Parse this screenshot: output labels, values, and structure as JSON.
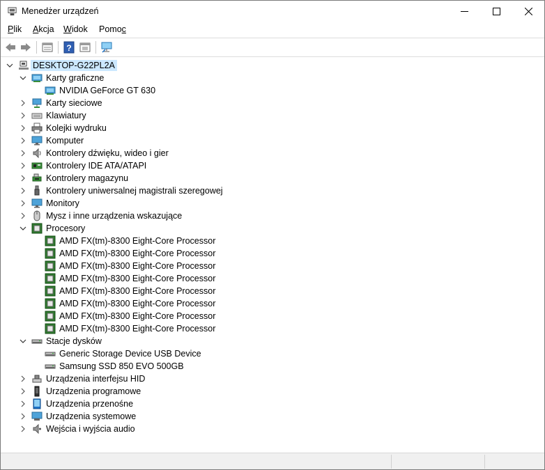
{
  "window": {
    "title": "Menedżer urządzeń"
  },
  "menu": [
    {
      "name": "menu-plik",
      "pre": "",
      "u": "P",
      "post": "lik"
    },
    {
      "name": "menu-akcja",
      "pre": "",
      "u": "A",
      "post": "kcja"
    },
    {
      "name": "menu-widok",
      "pre": "",
      "u": "W",
      "post": "idok"
    },
    {
      "name": "menu-pomoc",
      "pre": "Pomo",
      "u": "c",
      "post": ""
    }
  ],
  "toolbar": [
    "back-icon",
    "forward-icon",
    "properties-icon",
    "help-icon",
    "driver-details-icon",
    "scan-hardware-icon"
  ],
  "tree": {
    "root": "DESKTOP-G22PL2A",
    "rows": [
      {
        "label": "Karty graficzne",
        "level": 1,
        "state": "expanded",
        "icon": "display-adapter-icon"
      },
      {
        "label": "NVIDIA GeForce GT 630",
        "level": 2,
        "icon": "display-adapter-icon"
      },
      {
        "label": "Karty sieciowe",
        "level": 1,
        "state": "collapsed",
        "icon": "network-adapter-icon"
      },
      {
        "label": "Klawiatury",
        "level": 1,
        "state": "collapsed",
        "icon": "keyboard-icon"
      },
      {
        "label": "Kolejki wydruku",
        "level": 1,
        "state": "collapsed",
        "icon": "printer-icon"
      },
      {
        "label": "Komputer",
        "level": 1,
        "state": "collapsed",
        "icon": "computer-icon"
      },
      {
        "label": "Kontrolery dźwięku, wideo i gier",
        "level": 1,
        "state": "collapsed",
        "icon": "speaker-icon"
      },
      {
        "label": "Kontrolery IDE ATA/ATAPI",
        "level": 1,
        "state": "collapsed",
        "icon": "ide-controller-icon"
      },
      {
        "label": "Kontrolery magazynu",
        "level": 1,
        "state": "collapsed",
        "icon": "storage-controller-icon"
      },
      {
        "label": "Kontrolery uniwersalnej magistrali szeregowej",
        "level": 1,
        "state": "collapsed",
        "icon": "usb-icon"
      },
      {
        "label": "Monitory",
        "level": 1,
        "state": "collapsed",
        "icon": "monitor-icon"
      },
      {
        "label": "Mysz i inne urządzenia wskazujące",
        "level": 1,
        "state": "collapsed",
        "icon": "mouse-icon"
      },
      {
        "label": "Procesory",
        "level": 1,
        "state": "expanded",
        "icon": "processor-icon"
      },
      {
        "label": "AMD FX(tm)-8300 Eight-Core Processor",
        "level": 2,
        "icon": "processor-icon"
      },
      {
        "label": "AMD FX(tm)-8300 Eight-Core Processor",
        "level": 2,
        "icon": "processor-icon"
      },
      {
        "label": "AMD FX(tm)-8300 Eight-Core Processor",
        "level": 2,
        "icon": "processor-icon"
      },
      {
        "label": "AMD FX(tm)-8300 Eight-Core Processor",
        "level": 2,
        "icon": "processor-icon"
      },
      {
        "label": "AMD FX(tm)-8300 Eight-Core Processor",
        "level": 2,
        "icon": "processor-icon"
      },
      {
        "label": "AMD FX(tm)-8300 Eight-Core Processor",
        "level": 2,
        "icon": "processor-icon"
      },
      {
        "label": "AMD FX(tm)-8300 Eight-Core Processor",
        "level": 2,
        "icon": "processor-icon"
      },
      {
        "label": "AMD FX(tm)-8300 Eight-Core Processor",
        "level": 2,
        "icon": "processor-icon"
      },
      {
        "label": "Stacje dysków",
        "level": 1,
        "state": "expanded",
        "icon": "disk-drive-icon"
      },
      {
        "label": "Generic Storage Device USB Device",
        "level": 2,
        "icon": "disk-drive-icon"
      },
      {
        "label": "Samsung SSD 850 EVO 500GB",
        "level": 2,
        "icon": "disk-drive-icon"
      },
      {
        "label": "Urządzenia interfejsu HID",
        "level": 1,
        "state": "collapsed",
        "icon": "hid-icon"
      },
      {
        "label": "Urządzenia programowe",
        "level": 1,
        "state": "collapsed",
        "icon": "software-device-icon"
      },
      {
        "label": "Urządzenia przenośne",
        "level": 1,
        "state": "collapsed",
        "icon": "portable-device-icon"
      },
      {
        "label": "Urządzenia systemowe",
        "level": 1,
        "state": "collapsed",
        "icon": "system-device-icon"
      },
      {
        "label": "Wejścia i wyjścia audio",
        "level": 1,
        "state": "collapsed",
        "icon": "audio-io-icon"
      }
    ]
  },
  "colors": {
    "selection": "#cce8ff",
    "accent": "#1e73c8"
  }
}
